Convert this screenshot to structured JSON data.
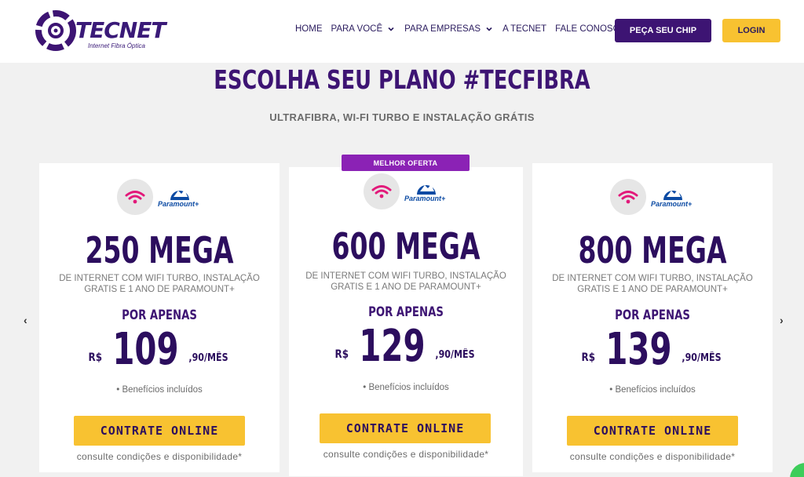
{
  "brand": {
    "name": "TECNET",
    "tagline": "Internet Fibra Óptica",
    "colors": {
      "primary": "#3d1473",
      "accent": "#f8c231",
      "badge": "#8b22b5",
      "wifi": "#e2197a"
    }
  },
  "nav": {
    "items": [
      {
        "label": "HOME",
        "dropdown": false
      },
      {
        "label": "PARA VOCÊ",
        "dropdown": true
      },
      {
        "label": "PARA EMPRESAS",
        "dropdown": true
      },
      {
        "label": "A TECNET",
        "dropdown": false
      },
      {
        "label": "FALE CONOSCO",
        "dropdown": false
      }
    ],
    "chip_button": "PEÇA SEU CHIP",
    "login_button": "LOGIN"
  },
  "section": {
    "title": "ESCOLHA SEU PLANO #TECFIBRA",
    "subtitle": "ULTRAFIBRA, WI-FI TURBO E INSTALAÇÃO GRÁTIS"
  },
  "badge": "MELHOR OFERTA",
  "plans": [
    {
      "speed": "250 MEGA",
      "description": "DE INTERNET COM WIFI TURBO, INSTALAÇÃO GRATIS E 1 ANO DE PARAMOUNT+",
      "por_apenas": "POR APENAS",
      "currency": "R$",
      "price": "109",
      "cents": ",90/MÊS",
      "benefits": "• Benefícios incluídos",
      "cta": "CONTRATE ONLINE",
      "conditions": "consulte condições e disponibilidade*",
      "partner": "Paramount+"
    },
    {
      "speed": "600 MEGA",
      "description": "DE INTERNET COM WIFI TURBO, INSTALAÇÃO GRATIS E 1 ANO DE PARAMOUNT+",
      "por_apenas": "POR APENAS",
      "currency": "R$",
      "price": "129",
      "cents": ",90/MÊS",
      "benefits": "• Benefícios incluídos",
      "cta": "CONTRATE ONLINE",
      "conditions": "consulte condições e disponibilidade*",
      "partner": "Paramount+"
    },
    {
      "speed": "800 MEGA",
      "description": "DE INTERNET COM WIFI TURBO, INSTALAÇÃO GRATIS E 1 ANO DE PARAMOUNT+",
      "por_apenas": "POR APENAS",
      "currency": "R$",
      "price": "139",
      "cents": ",90/MÊS",
      "benefits": "• Benefícios incluídos",
      "cta": "CONTRATE ONLINE",
      "conditions": "consulte condições e disponibilidade*",
      "partner": "Paramount+"
    }
  ],
  "carousel": {
    "prev": "‹",
    "next": "›"
  }
}
